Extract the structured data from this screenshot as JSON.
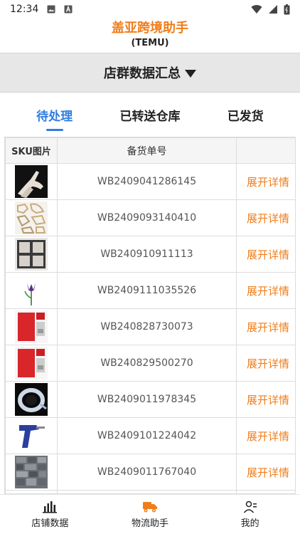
{
  "status": {
    "time": "12:34"
  },
  "header": {
    "title": "盖亚跨境助手",
    "subtitle": "(TEMU)"
  },
  "summary": {
    "label": "店群数据汇总"
  },
  "tabs": [
    {
      "label": "待处理",
      "active": true
    },
    {
      "label": "已转送仓库",
      "active": false
    },
    {
      "label": "已发货",
      "active": false
    }
  ],
  "table": {
    "headers": {
      "image": "SKU图片",
      "order": "备货单号",
      "action": ""
    },
    "rows": [
      {
        "order": "WB2409041286145",
        "action": "展开详情",
        "thumb": "gloves"
      },
      {
        "order": "WB2409093140410",
        "action": "展开详情",
        "thumb": "cookie-cutters"
      },
      {
        "order": "WB240910911113",
        "action": "展开详情",
        "thumb": "mold"
      },
      {
        "order": "WB2409111035526",
        "action": "展开详情",
        "thumb": "tulip"
      },
      {
        "order": "WB240828730073",
        "action": "展开详情",
        "thumb": "red-case"
      },
      {
        "order": "WB240829500270",
        "action": "展开详情",
        "thumb": "red-case"
      },
      {
        "order": "WB2409011978345",
        "action": "展开详情",
        "thumb": "tape"
      },
      {
        "order": "WB2409101224042",
        "action": "展开详情",
        "thumb": "glue-gun"
      },
      {
        "order": "WB2409011767040",
        "action": "展开详情",
        "thumb": "wall-tile"
      }
    ]
  },
  "bottom_nav": [
    {
      "label": "店铺数据",
      "icon": "bar-chart-icon"
    },
    {
      "label": "物流助手",
      "icon": "truck-icon"
    },
    {
      "label": "我的",
      "icon": "user-icon"
    }
  ],
  "colors": {
    "accent": "#f07d1a",
    "tab_active": "#2f7de1"
  }
}
